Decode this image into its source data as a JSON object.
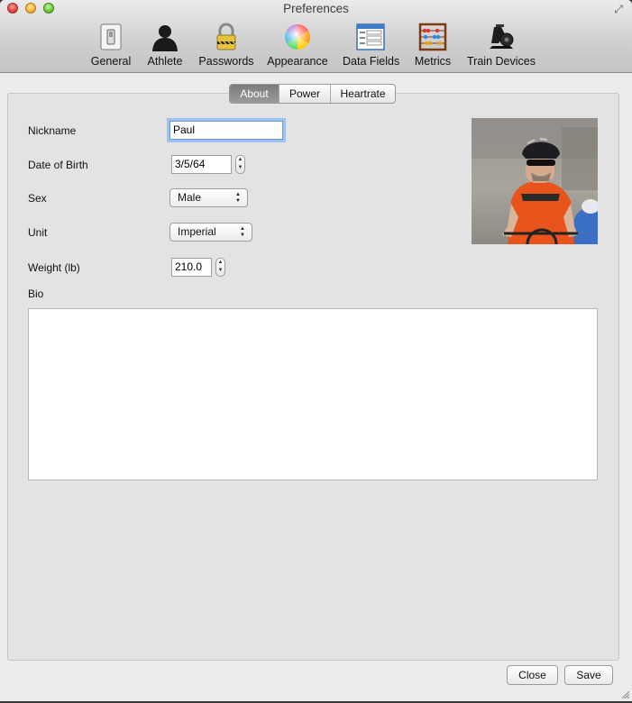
{
  "window": {
    "title": "Preferences"
  },
  "toolbar": {
    "items": [
      {
        "label": "General",
        "icon": "light-switch-icon"
      },
      {
        "label": "Athlete",
        "icon": "person-silhouette-icon"
      },
      {
        "label": "Passwords",
        "icon": "padlock-icon"
      },
      {
        "label": "Appearance",
        "icon": "color-wheel-icon"
      },
      {
        "label": "Data Fields",
        "icon": "form-window-icon"
      },
      {
        "label": "Metrics",
        "icon": "abacus-icon"
      },
      {
        "label": "Train Devices",
        "icon": "bike-trainer-icon"
      }
    ]
  },
  "tabs": [
    {
      "label": "About",
      "active": true
    },
    {
      "label": "Power",
      "active": false
    },
    {
      "label": "Heartrate",
      "active": false
    }
  ],
  "form": {
    "nickname": {
      "label": "Nickname",
      "value": "Paul"
    },
    "dob": {
      "label": "Date of Birth",
      "value": "3/5/64"
    },
    "sex": {
      "label": "Sex",
      "value": "Male"
    },
    "unit": {
      "label": "Unit",
      "value": "Imperial"
    },
    "weight": {
      "label": "Weight (lb)",
      "value": "210.0"
    },
    "bio": {
      "label": "Bio",
      "value": ""
    }
  },
  "buttons": {
    "close": "Close",
    "save": "Save"
  },
  "colors": {
    "focus_ring": "#9cc3f0",
    "active_tab": "#8a8a8a",
    "jersey_orange": "#e8541c"
  }
}
